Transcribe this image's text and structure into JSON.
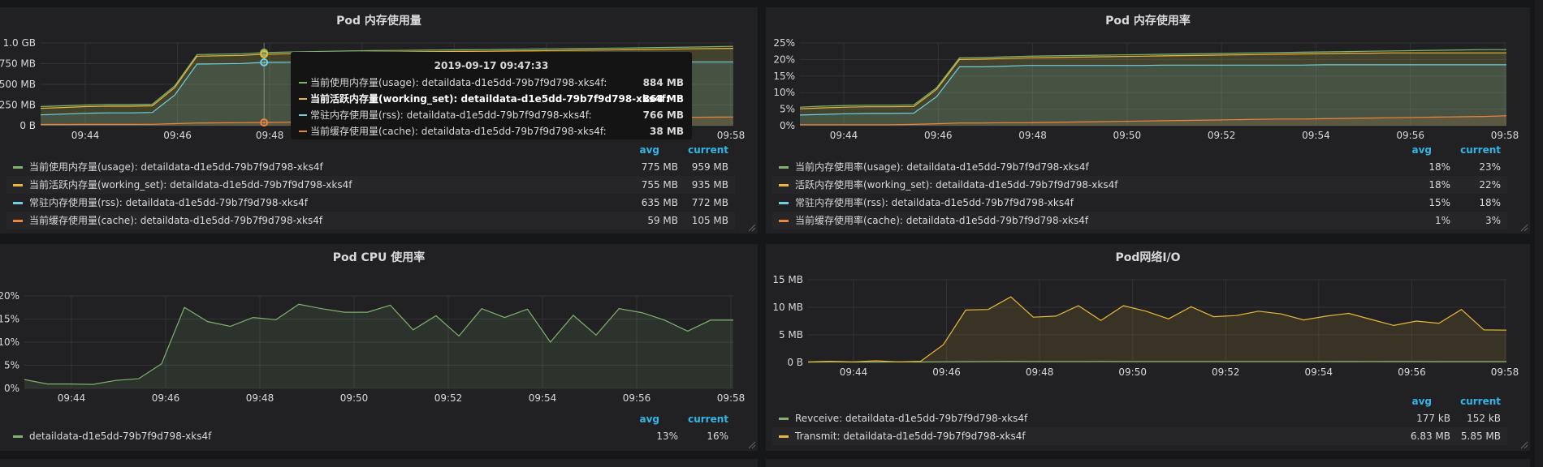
{
  "colors": {
    "green": "#7eb26d",
    "yellow": "#eab839",
    "cyan": "#6ed0e0",
    "orange": "#ef843c",
    "header_blue": "#33b5e5"
  },
  "legend_headers": {
    "avg": "avg",
    "current": "current"
  },
  "panels": {
    "mem_usage": {
      "title": "Pod 内存使用量",
      "y_ticks": [
        "1.0 GB",
        "750 MB",
        "500 MB",
        "250 MB",
        "0 B"
      ],
      "x_ticks": [
        "09:44",
        "09:46",
        "09:48",
        "09:50",
        "09:52",
        "09:54",
        "09:56",
        "09:58"
      ],
      "legend": [
        {
          "name": "当前使用内存量(usage): detaildata-d1e5dd-79b7f9d798-xks4f",
          "color": "#7eb26d",
          "avg": "775 MB",
          "current": "959 MB"
        },
        {
          "name": "当前活跃内存量(working_set): detaildata-d1e5dd-79b7f9d798-xks4f",
          "color": "#eab839",
          "avg": "755 MB",
          "current": "935 MB"
        },
        {
          "name": "常驻内存使用量(rss): detaildata-d1e5dd-79b7f9d798-xks4f",
          "color": "#6ed0e0",
          "avg": "635 MB",
          "current": "772 MB"
        },
        {
          "name": "当前缓存使用量(cache): detaildata-d1e5dd-79b7f9d798-xks4f",
          "color": "#ef843c",
          "avg": "59 MB",
          "current": "105 MB"
        }
      ],
      "tooltip": {
        "time": "2019-09-17 09:47:33",
        "rows": [
          {
            "name": "当前使用内存量(usage): detaildata-d1e5dd-79b7f9d798-xks4f:",
            "color": "#7eb26d",
            "value": "884 MB"
          },
          {
            "name": "当前活跃内存量(working_set): detaildata-d1e5dd-79b7f9d798-xks4f:",
            "color": "#eab839",
            "value": "864 MB"
          },
          {
            "name": "常驻内存使用量(rss): detaildata-d1e5dd-79b7f9d798-xks4f:",
            "color": "#6ed0e0",
            "value": "766 MB"
          },
          {
            "name": "当前缓存使用量(cache): detaildata-d1e5dd-79b7f9d798-xks4f:",
            "color": "#ef843c",
            "value": "38 MB"
          }
        ]
      }
    },
    "mem_rate": {
      "title": "Pod 内存使用率",
      "y_ticks": [
        "25%",
        "20%",
        "15%",
        "10%",
        "5%",
        "0%"
      ],
      "x_ticks": [
        "09:44",
        "09:46",
        "09:48",
        "09:50",
        "09:52",
        "09:54",
        "09:56",
        "09:58"
      ],
      "legend": [
        {
          "name": "当前内存使用率(usage): detaildata-d1e5dd-79b7f9d798-xks4f",
          "color": "#7eb26d",
          "avg": "18%",
          "current": "23%"
        },
        {
          "name": "活跃内存使用率(working_set): detaildata-d1e5dd-79b7f9d798-xks4f",
          "color": "#eab839",
          "avg": "18%",
          "current": "22%"
        },
        {
          "name": "常驻内存使用率(rss): detaildata-d1e5dd-79b7f9d798-xks4f",
          "color": "#6ed0e0",
          "avg": "15%",
          "current": "18%"
        },
        {
          "name": "当前缓存使用率(cache): detaildata-d1e5dd-79b7f9d798-xks4f",
          "color": "#ef843c",
          "avg": "1%",
          "current": "3%"
        }
      ]
    },
    "cpu": {
      "title": "Pod CPU 使用率",
      "y_ticks": [
        "20%",
        "15%",
        "10%",
        "5%",
        "0%"
      ],
      "x_ticks": [
        "09:44",
        "09:46",
        "09:48",
        "09:50",
        "09:52",
        "09:54",
        "09:56",
        "09:58"
      ],
      "legend": [
        {
          "name": "detaildata-d1e5dd-79b7f9d798-xks4f",
          "color": "#7eb26d",
          "avg": "13%",
          "current": "16%"
        }
      ]
    },
    "net": {
      "title": "Pod网络I/O",
      "y_ticks": [
        "15 MB",
        "10 MB",
        "5 MB",
        "0 B"
      ],
      "x_ticks": [
        "09:44",
        "09:46",
        "09:48",
        "09:50",
        "09:52",
        "09:54",
        "09:56",
        "09:58"
      ],
      "legend": [
        {
          "name": "Revceive: detaildata-d1e5dd-79b7f9d798-xks4f",
          "color": "#7eb26d",
          "avg": "177 kB",
          "current": "152 kB"
        },
        {
          "name": "Transmit: detaildata-d1e5dd-79b7f9d798-xks4f",
          "color": "#eab839",
          "avg": "6.83 MB",
          "current": "5.85 MB"
        }
      ]
    }
  },
  "chart_data": [
    {
      "type": "area",
      "title": "Pod 内存使用量",
      "x": [
        0,
        1,
        2,
        3,
        4,
        5,
        6,
        7,
        8,
        9,
        10,
        11,
        12,
        13,
        14,
        15,
        16,
        17,
        18,
        19,
        20,
        21,
        22,
        23,
        24,
        25,
        26,
        27,
        28,
        29,
        30,
        31
      ],
      "xlim_minutes": [
        "09:43",
        "09:58:30"
      ],
      "ylim": [
        0,
        1000
      ],
      "y_unit": "MB",
      "series": [
        {
          "name": "当前使用内存量(usage): detaildata-d1e5dd-79b7f9d798-xks4f",
          "color": "#7eb26d",
          "values": [
            230,
            240,
            250,
            255,
            255,
            260,
            480,
            860,
            865,
            870,
            884,
            890,
            895,
            900,
            905,
            908,
            910,
            913,
            916,
            918,
            920,
            923,
            926,
            929,
            932,
            935,
            938,
            942,
            946,
            950,
            955,
            959
          ]
        },
        {
          "name": "当前活跃内存量(working_set): detaildata-d1e5dd-79b7f9d798-xks4f",
          "color": "#eab839",
          "values": [
            210,
            220,
            230,
            235,
            235,
            240,
            460,
            840,
            845,
            850,
            864,
            870,
            875,
            880,
            885,
            888,
            890,
            893,
            896,
            898,
            900,
            903,
            906,
            909,
            912,
            915,
            918,
            921,
            925,
            929,
            932,
            935
          ]
        },
        {
          "name": "常驻内存使用量(rss): detaildata-d1e5dd-79b7f9d798-xks4f",
          "color": "#6ed0e0",
          "values": [
            130,
            140,
            150,
            155,
            155,
            160,
            370,
            745,
            748,
            752,
            766,
            768,
            768,
            768,
            768,
            768,
            769,
            769,
            769,
            770,
            770,
            770,
            770,
            771,
            771,
            771,
            771,
            772,
            772,
            772,
            772,
            772
          ]
        },
        {
          "name": "当前缓存使用量(cache): detaildata-d1e5dd-79b7f9d798-xks4f",
          "color": "#ef843c",
          "values": [
            15,
            15,
            16,
            16,
            16,
            17,
            25,
            32,
            34,
            36,
            38,
            42,
            46,
            50,
            54,
            58,
            62,
            66,
            70,
            73,
            76,
            79,
            82,
            85,
            88,
            91,
            94,
            97,
            99,
            101,
            103,
            105
          ]
        }
      ]
    },
    {
      "type": "area",
      "title": "Pod 内存使用率",
      "x": [
        0,
        1,
        2,
        3,
        4,
        5,
        6,
        7,
        8,
        9,
        10,
        11,
        12,
        13,
        14,
        15,
        16,
        17,
        18,
        19,
        20,
        21,
        22,
        23,
        24,
        25,
        26,
        27,
        28,
        29,
        30,
        31
      ],
      "ylim": [
        0,
        25
      ],
      "y_unit": "%",
      "series": [
        {
          "name": "当前内存使用率(usage): detaildata-d1e5dd-79b7f9d798-xks4f",
          "color": "#7eb26d",
          "values": [
            5.6,
            5.9,
            6.1,
            6.2,
            6.2,
            6.3,
            11.5,
            20.5,
            20.6,
            20.8,
            21.0,
            21.1,
            21.2,
            21.3,
            21.4,
            21.5,
            21.6,
            21.7,
            21.8,
            21.9,
            22.0,
            22.1,
            22.2,
            22.3,
            22.4,
            22.5,
            22.6,
            22.7,
            22.8,
            22.9,
            23.0,
            23.0
          ]
        },
        {
          "name": "活跃内存使用率(working_set): detaildata-d1e5dd-79b7f9d798-xks4f",
          "color": "#eab839",
          "values": [
            5.1,
            5.4,
            5.6,
            5.7,
            5.7,
            5.8,
            11.0,
            20.0,
            20.1,
            20.3,
            20.5,
            20.6,
            20.7,
            20.8,
            20.9,
            21.0,
            21.1,
            21.2,
            21.3,
            21.4,
            21.5,
            21.6,
            21.7,
            21.8,
            21.9,
            21.9,
            22.0,
            22.0,
            22.0,
            22.0,
            22.0,
            22.0
          ]
        },
        {
          "name": "常驻内存使用率(rss): detaildata-d1e5dd-79b7f9d798-xks4f",
          "color": "#6ed0e0",
          "values": [
            3.2,
            3.4,
            3.6,
            3.7,
            3.7,
            3.8,
            8.8,
            17.8,
            17.8,
            18.0,
            18.2,
            18.2,
            18.2,
            18.2,
            18.2,
            18.2,
            18.3,
            18.3,
            18.3,
            18.3,
            18.3,
            18.3,
            18.3,
            18.4,
            18.4,
            18.4,
            18.4,
            18.4,
            18.4,
            18.4,
            18.4,
            18.4
          ]
        },
        {
          "name": "当前缓存使用率(cache): detaildata-d1e5dd-79b7f9d798-xks4f",
          "color": "#ef843c",
          "values": [
            0.3,
            0.3,
            0.3,
            0.3,
            0.3,
            0.4,
            0.6,
            0.8,
            0.8,
            0.9,
            0.9,
            1.0,
            1.1,
            1.2,
            1.3,
            1.4,
            1.5,
            1.6,
            1.7,
            1.8,
            1.9,
            2.0,
            2.0,
            2.1,
            2.2,
            2.3,
            2.4,
            2.5,
            2.6,
            2.7,
            2.8,
            3.0
          ]
        }
      ]
    },
    {
      "type": "area",
      "title": "Pod CPU 使用率",
      "x": [
        0,
        1,
        2,
        3,
        4,
        5,
        6,
        7,
        8,
        9,
        10,
        11,
        12,
        13,
        14,
        15,
        16,
        17,
        18,
        19,
        20,
        21,
        22,
        23,
        24,
        25,
        26,
        27,
        28,
        29,
        30,
        31
      ],
      "ylim": [
        0,
        21
      ],
      "y_unit": "%",
      "series": [
        {
          "name": "detaildata-d1e5dd-79b7f9d798-xks4f",
          "color": "#7eb26d",
          "values": [
            2.0,
            1.0,
            1.0,
            0.9,
            1.8,
            2.2,
            5.6,
            18.4,
            15.2,
            14.1,
            16.1,
            15.6,
            19.1,
            18.1,
            17.3,
            17.3,
            18.9,
            13.3,
            16.5,
            11.9,
            18.1,
            16.1,
            18.0,
            10.5,
            16.6,
            12.1,
            18.1,
            17.2,
            15.5,
            13.0,
            15.5,
            15.5
          ]
        }
      ]
    },
    {
      "type": "area",
      "title": "Pod网络I/O",
      "x": [
        0,
        1,
        2,
        3,
        4,
        5,
        6,
        7,
        8,
        9,
        10,
        11,
        12,
        13,
        14,
        15,
        16,
        17,
        18,
        19,
        20,
        21,
        22,
        23,
        24,
        25,
        26,
        27,
        28,
        29,
        30,
        31
      ],
      "ylim": [
        0,
        15
      ],
      "y_unit": "MB",
      "series": [
        {
          "name": "Revceive: detaildata-d1e5dd-79b7f9d798-xks4f",
          "color": "#7eb26d",
          "values": [
            0.05,
            0.1,
            0.08,
            0.05,
            0.1,
            0.08,
            0.12,
            0.15,
            0.18,
            0.2,
            0.18,
            0.17,
            0.18,
            0.19,
            0.18,
            0.17,
            0.18,
            0.18,
            0.17,
            0.18,
            0.17,
            0.18,
            0.18,
            0.17,
            0.16,
            0.17,
            0.16,
            0.16,
            0.15,
            0.15,
            0.15,
            0.15
          ]
        },
        {
          "name": "Transmit: detaildata-d1e5dd-79b7f9d798-xks4f",
          "color": "#eab839",
          "values": [
            0.1,
            0.2,
            0.1,
            0.3,
            0.1,
            0.2,
            3.2,
            9.5,
            9.6,
            11.9,
            8.2,
            8.4,
            10.3,
            7.6,
            10.3,
            9.3,
            7.9,
            10.1,
            8.3,
            8.5,
            9.3,
            8.8,
            7.7,
            8.4,
            8.9,
            7.8,
            6.7,
            7.5,
            7.1,
            9.6,
            5.9,
            5.85
          ]
        }
      ]
    }
  ]
}
